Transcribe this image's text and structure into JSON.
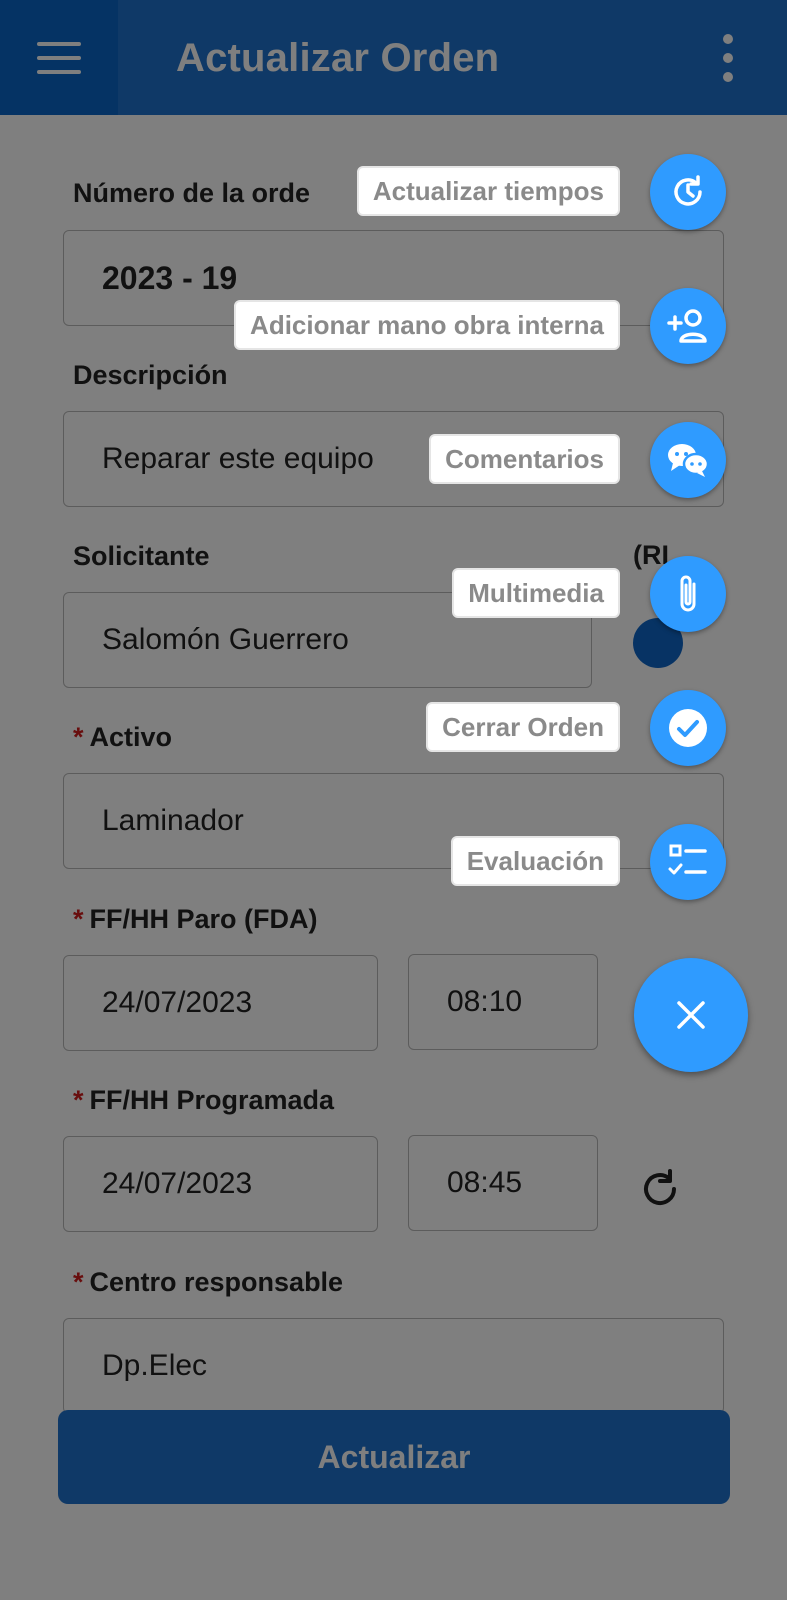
{
  "appbar": {
    "title": "Actualizar Orden"
  },
  "form": {
    "order_number": {
      "label": "Número de la orde",
      "value": "2023 - 19"
    },
    "description": {
      "label": "Descripción",
      "value": "Reparar este equipo"
    },
    "requester": {
      "label": "Solicitante",
      "value": "Salomón Guerrero",
      "side_label": "(RI"
    },
    "asset": {
      "required": "*",
      "label": "Activo",
      "value": "Laminador"
    },
    "stop_datetime": {
      "required": "*",
      "label": "FF/HH Paro (FDA)",
      "date": "24/07/2023",
      "time": "08:10"
    },
    "scheduled_datetime": {
      "required": "*",
      "label": "FF/HH Programada",
      "date": "24/07/2023",
      "time": "08:45"
    },
    "responsible_center": {
      "required": "*",
      "label": "Centro responsable",
      "value": "Dp.Elec"
    }
  },
  "update_button": {
    "label": "Actualizar"
  },
  "speed_dial": {
    "items": [
      {
        "label": "Actualizar tiempos",
        "icon": "clock-refresh-icon"
      },
      {
        "label": "Adicionar mano obra interna",
        "icon": "add-person-icon"
      },
      {
        "label": "Comentarios",
        "icon": "chat-icon"
      },
      {
        "label": "Multimedia",
        "icon": "paperclip-icon"
      },
      {
        "label": "Cerrar Orden",
        "icon": "check-circle-icon"
      },
      {
        "label": "Evaluación",
        "icon": "checklist-icon"
      }
    ],
    "close_icon": "close-icon"
  },
  "colors": {
    "primary": "#1e73cf",
    "fab": "#2f9bff",
    "required": "#d01c1c"
  }
}
